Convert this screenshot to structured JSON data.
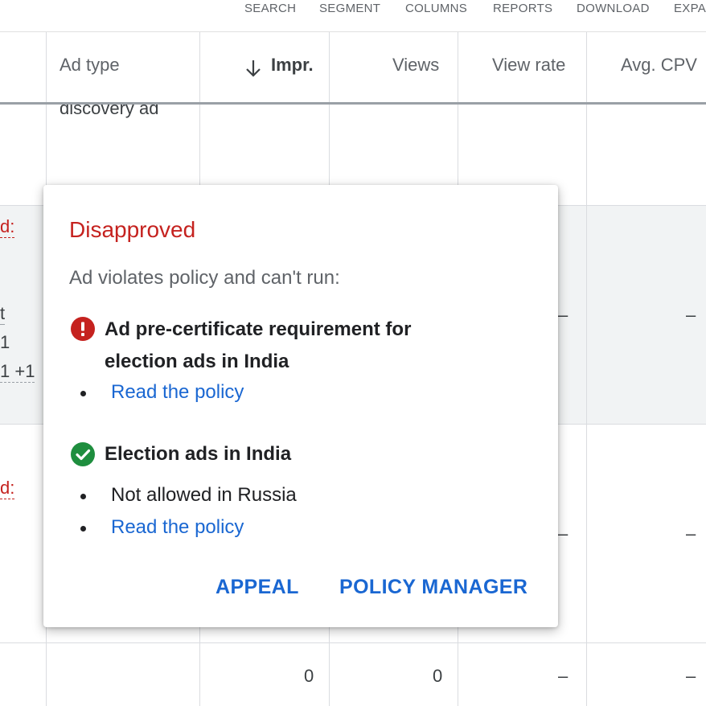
{
  "toolbar": {
    "search": "SEARCH",
    "segment": "SEGMENT",
    "columns": "COLUMNS",
    "reports": "REPORTS",
    "download": "DOWNLOAD",
    "expand": "EXPA"
  },
  "table": {
    "headers": {
      "ad_type": "Ad type",
      "impr": "Impr.",
      "views": "Views",
      "view_rate": "View rate",
      "avg_cpv": "Avg. CPV"
    },
    "row1": {
      "ad_type_fragment": "discovery ad"
    },
    "row2": {
      "status_fragment": "d:",
      "policy_fragment_1": "t",
      "policy_fragment_2": "1",
      "policy_fragment_3": "1 +1",
      "view_rate": "–",
      "avg_cpv": "–"
    },
    "row3": {
      "status_fragment": "d:",
      "view_rate": "–",
      "avg_cpv": "–"
    },
    "row4": {
      "impr": "0",
      "views": "0",
      "view_rate": "–",
      "avg_cpv": "–"
    }
  },
  "popup": {
    "title": "Disapproved",
    "subtitle": "Ad violates policy and can't run:",
    "policies": [
      {
        "icon": "error-icon",
        "title_line1": "Ad pre-certificate requirement for",
        "title_line2": "election ads in India",
        "link": "Read the policy"
      },
      {
        "icon": "check-circle-icon",
        "title": "Election ads in India",
        "note": "Not allowed in Russia",
        "link": "Read the policy"
      }
    ],
    "actions": {
      "appeal": "APPEAL",
      "policy_manager": "POLICY MANAGER"
    }
  },
  "colors": {
    "error_red": "#c5221f",
    "success_green": "#1e8e3e",
    "link_blue": "#1a67d2"
  }
}
